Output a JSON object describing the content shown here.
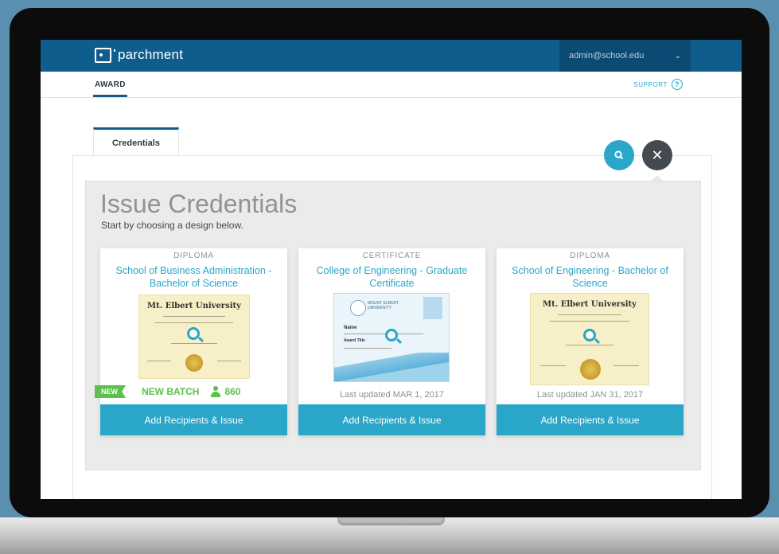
{
  "app": {
    "brand": "parchment"
  },
  "header": {
    "user_email": "admin@school.edu"
  },
  "subnav": {
    "award_label": "AWARD",
    "support_label": "SUPPORT"
  },
  "tabs": [
    {
      "label": "Credentials"
    }
  ],
  "issue": {
    "title": "Issue Credentials",
    "subtitle": "Start by choosing a design below.",
    "cards": [
      {
        "type": "DIPLOMA",
        "name": "School of Business Administration - Bachelor of Science",
        "thumbnail_heading": "Mt. Elbert University",
        "badge": "NEW",
        "batch_label": "NEW BATCH",
        "recipient_count": "860",
        "button_label": "Add Recipients & Issue"
      },
      {
        "type": "CERTIFICATE",
        "name": "College of Engineering - Graduate Certificate",
        "thumbnail_heading": "MOUNT ELBERT UNIVERSITY",
        "thumbnail_name": "Name",
        "thumbnail_award": "Award Title",
        "last_updated": "Last updated MAR 1, 2017",
        "button_label": "Add Recipients & Issue"
      },
      {
        "type": "DIPLOMA",
        "name": "School of Engineering - Bachelor of Science",
        "thumbnail_heading": "Mt. Elbert University",
        "last_updated": "Last updated JAN 31, 2017",
        "button_label": "Add Recipients & Issue"
      }
    ]
  },
  "icons": {
    "search": "search-icon",
    "close": "close-icon",
    "help": "help-icon",
    "dropdown": "chevron-down-icon",
    "user": "person-icon"
  },
  "colors": {
    "brand_blue": "#0f5d8d",
    "accent": "#2aa6c9",
    "success": "#5cc04a",
    "panel_bg": "#ebebeb"
  }
}
